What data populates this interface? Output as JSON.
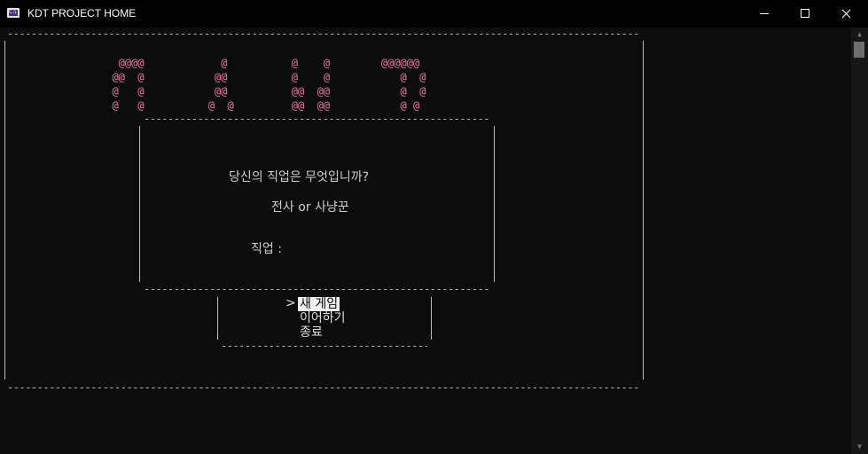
{
  "window": {
    "title": "KDT PROJECT HOME",
    "icon": "console-icon"
  },
  "banner": {
    "rows": [
      "   @@@@            @          @    @        @@@@@@",
      "  @@  @           @@          @    @           @  @",
      "  @   @           @@          @@  @@           @  @",
      "  @   @          @  @         @@  @@           @ @"
    ],
    "color": "#f17aa4"
  },
  "dialog": {
    "question": "당신의 직업은 무엇입니까?",
    "options": "전사 or 사냥꾼",
    "input_label": "직업 :",
    "input_value": ""
  },
  "menu": {
    "cursor": ">",
    "items": [
      {
        "label": "새 게임",
        "selected": true
      },
      {
        "label": "이어하기",
        "selected": false
      },
      {
        "label": "종료",
        "selected": false
      }
    ]
  },
  "scrollbar": {
    "up": "▲",
    "down": "▼"
  }
}
